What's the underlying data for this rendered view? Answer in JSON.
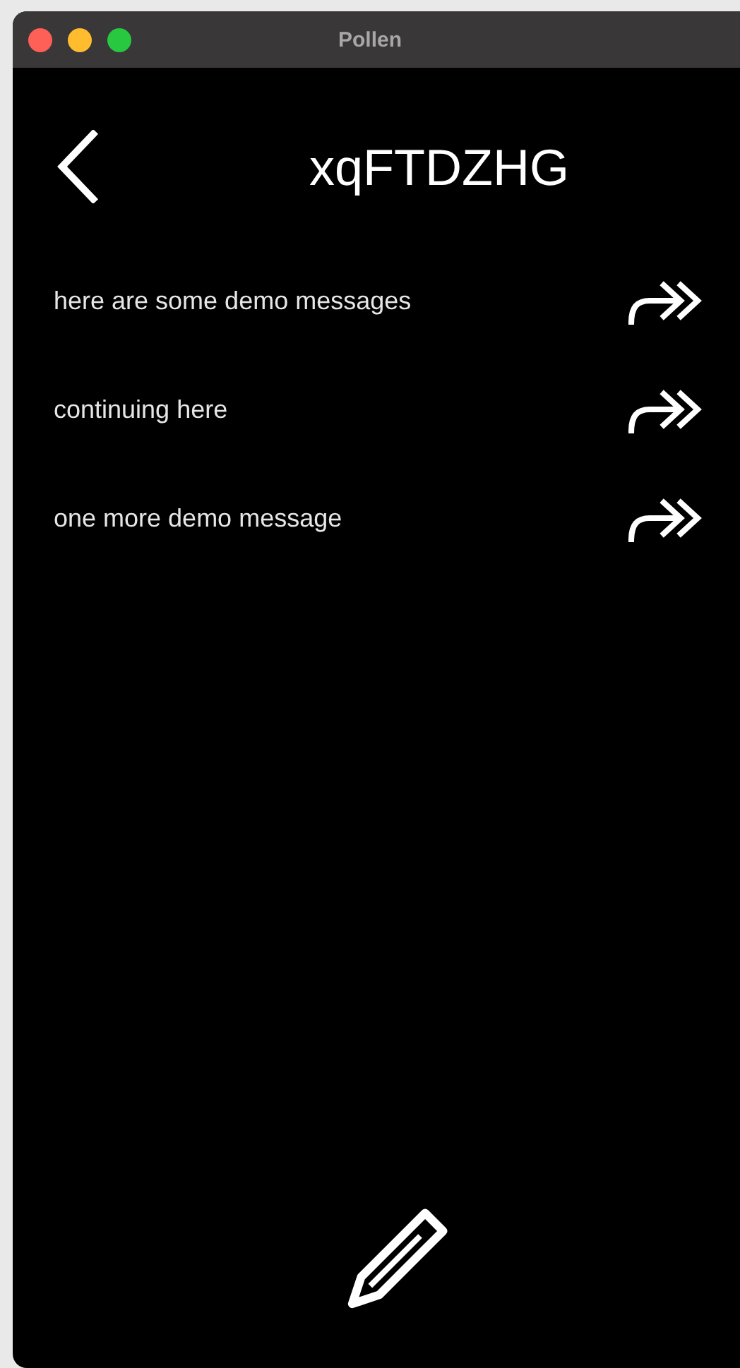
{
  "window": {
    "title": "Pollen"
  },
  "header": {
    "title": "xqFTDZHG"
  },
  "messages": [
    {
      "text": "here are some demo messages"
    },
    {
      "text": "continuing here"
    },
    {
      "text": "one more demo message"
    }
  ]
}
